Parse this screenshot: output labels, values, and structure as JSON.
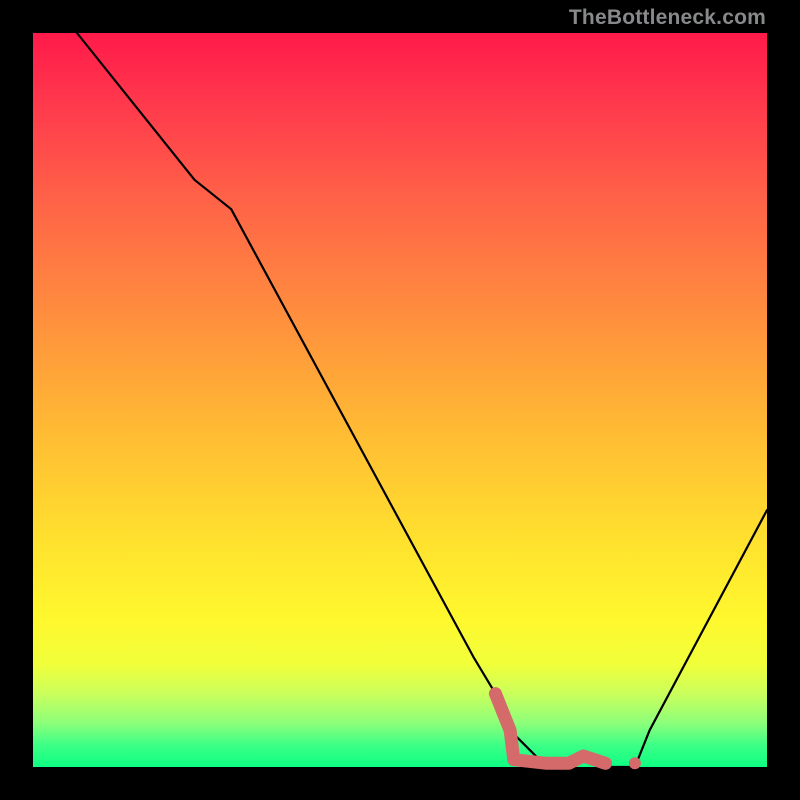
{
  "watermark": "TheBottleneck.com",
  "chart_data": {
    "type": "line",
    "title": "",
    "xlabel": "",
    "ylabel": "",
    "xlim": [
      0,
      100
    ],
    "ylim": [
      0,
      100
    ],
    "series": [
      {
        "name": "bottleneck-curve",
        "x": [
          0,
          6,
          22,
          27,
          60,
          63,
          65,
          70,
          73,
          75,
          78,
          82,
          84,
          100
        ],
        "values": [
          110,
          100,
          80,
          76,
          15,
          10,
          5,
          0,
          0,
          1,
          0,
          0,
          5,
          35
        ]
      }
    ],
    "markers": {
      "name": "highlight-segment",
      "color": "#d46a6a",
      "points": [
        {
          "x": 63,
          "y": 10
        },
        {
          "x": 65,
          "y": 5
        },
        {
          "x": 65.5,
          "y": 1
        },
        {
          "x": 70,
          "y": 0.5
        },
        {
          "x": 73,
          "y": 0.5
        },
        {
          "x": 75,
          "y": 1.5
        },
        {
          "x": 78,
          "y": 0.5
        },
        {
          "x": 82,
          "y": 0.5
        }
      ]
    }
  }
}
